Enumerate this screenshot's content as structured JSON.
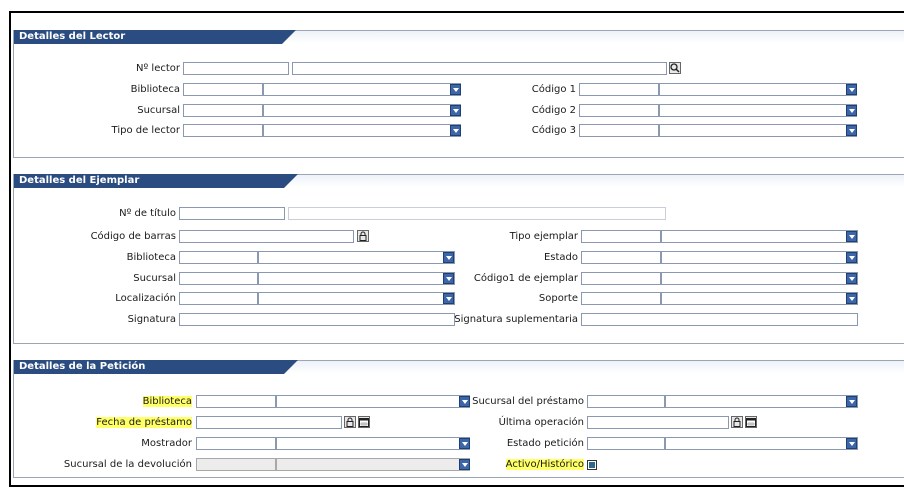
{
  "panels": {
    "lector": {
      "title": "Detalles del Lector",
      "labels": {
        "num_lector": "Nº lector",
        "biblioteca": "Biblioteca",
        "sucursal": "Sucursal",
        "tipo_lector": "Tipo de lector",
        "codigo1": "Código 1",
        "codigo2": "Código 2",
        "codigo3": "Código 3"
      },
      "icons": {
        "search": "magnifier-icon"
      }
    },
    "ejemplar": {
      "title": "Detalles del Ejemplar",
      "labels": {
        "num_titulo": "Nº de título",
        "codigo_barras": "Código de barras",
        "biblioteca": "Biblioteca",
        "sucursal": "Sucursal",
        "localizacion": "Localización",
        "signatura": "Signatura",
        "tipo_ejemplar": "Tipo ejemplar",
        "estado": "Estado",
        "codigo1_ejemplar": "Código1 de ejemplar",
        "soporte": "Soporte",
        "signatura_suplementaria": "Signatura suplementaria"
      }
    },
    "peticion": {
      "title": "Detalles de la Petición",
      "labels": {
        "biblioteca": "Biblioteca",
        "fecha_prestamo": "Fecha de préstamo",
        "mostrador": "Mostrador",
        "sucursal_devolucion": "Sucursal de la devolución",
        "sucursal_prestamo": "Sucursal del préstamo",
        "ultima_operacion": "Última operación",
        "estado_peticion": "Estado petición",
        "activo_historico": "Activo/Histórico"
      },
      "highlight_color": "#ffff66",
      "activo_historico_checked": true
    }
  },
  "colors": {
    "header": "#2b4c80",
    "dropdown": "#3c66a8"
  }
}
